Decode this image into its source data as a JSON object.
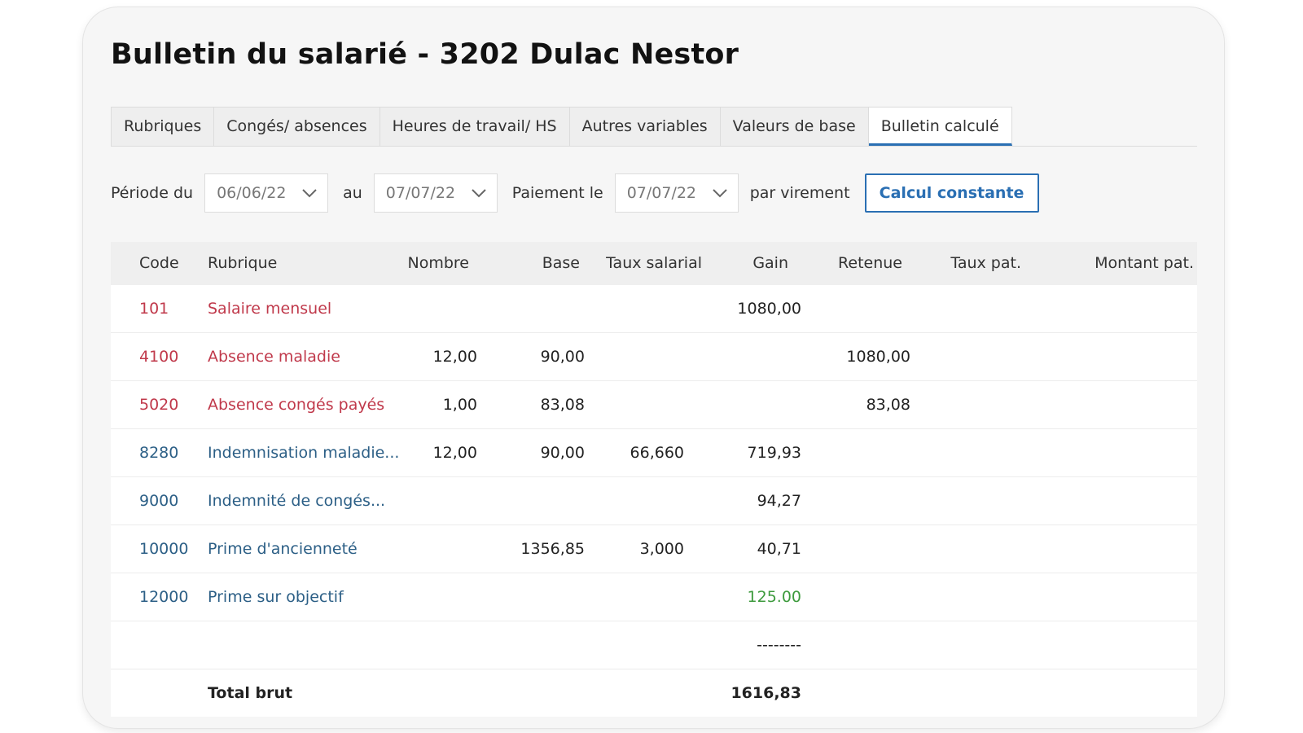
{
  "title": "Bulletin du salarié - 3202 Dulac Nestor",
  "tabs": [
    "Rubriques",
    "Congés/ absences",
    "Heures de travail/ HS",
    "Autres variables",
    "Valeurs de base",
    "Bulletin calculé"
  ],
  "active_tab": "Bulletin calculé",
  "filters": {
    "period_label": "Période du",
    "period_from": "06/06/22",
    "to_label": "au",
    "period_to": "07/07/22",
    "payment_label": "Paiement le",
    "payment_date": "07/07/22",
    "payment_method": "par virement",
    "calc_button": "Calcul constante"
  },
  "columns": {
    "code": "Code",
    "rubrique": "Rubrique",
    "nombre": "Nombre",
    "base": "Base",
    "taux_salarial": "Taux salarial",
    "gain": "Gain",
    "retenue": "Retenue",
    "taux_pat": "Taux pat.",
    "montant_pat": "Montant pat."
  },
  "rows": [
    {
      "code": "101",
      "rubrique": "Salaire mensuel",
      "nombre": "",
      "base": "",
      "taux": "",
      "gain": "1080,00",
      "retenue": "",
      "color": "red"
    },
    {
      "code": "4100",
      "rubrique": "Absence maladie",
      "nombre": "12,00",
      "base": "90,00",
      "taux": "",
      "gain": "",
      "retenue": "1080,00",
      "color": "red"
    },
    {
      "code": "5020",
      "rubrique": "Absence congés payés",
      "nombre": "1,00",
      "base": "83,08",
      "taux": "",
      "gain": "",
      "retenue": "83,08",
      "color": "red"
    },
    {
      "code": "8280",
      "rubrique": "Indemnisation maladie...",
      "nombre": "12,00",
      "base": "90,00",
      "taux": "66,660",
      "gain": "719,93",
      "retenue": "",
      "color": "blue"
    },
    {
      "code": "9000",
      "rubrique": "Indemnité de congés...",
      "nombre": "",
      "base": "",
      "taux": "",
      "gain": "94,27",
      "retenue": "",
      "color": "blue"
    },
    {
      "code": "10000",
      "rubrique": "Prime d'ancienneté",
      "nombre": "",
      "base": "1356,85",
      "taux": "3,000",
      "gain": "40,71",
      "retenue": "",
      "color": "blue"
    },
    {
      "code": "12000",
      "rubrique": "Prime sur objectif",
      "nombre": "",
      "base": "",
      "taux": "",
      "gain": "125.00",
      "retenue": "",
      "color": "blue",
      "gain_color": "green"
    }
  ],
  "separator": "--------",
  "total": {
    "label": "Total brut",
    "gain": "1616,83"
  },
  "colors": {
    "accent": "#2a6fb3",
    "code_red": "#c0394b",
    "code_blue": "#2c5f86",
    "highlight_green": "#3d9a3d"
  },
  "icons": {
    "select_chevron": "chevron-down-icon"
  }
}
